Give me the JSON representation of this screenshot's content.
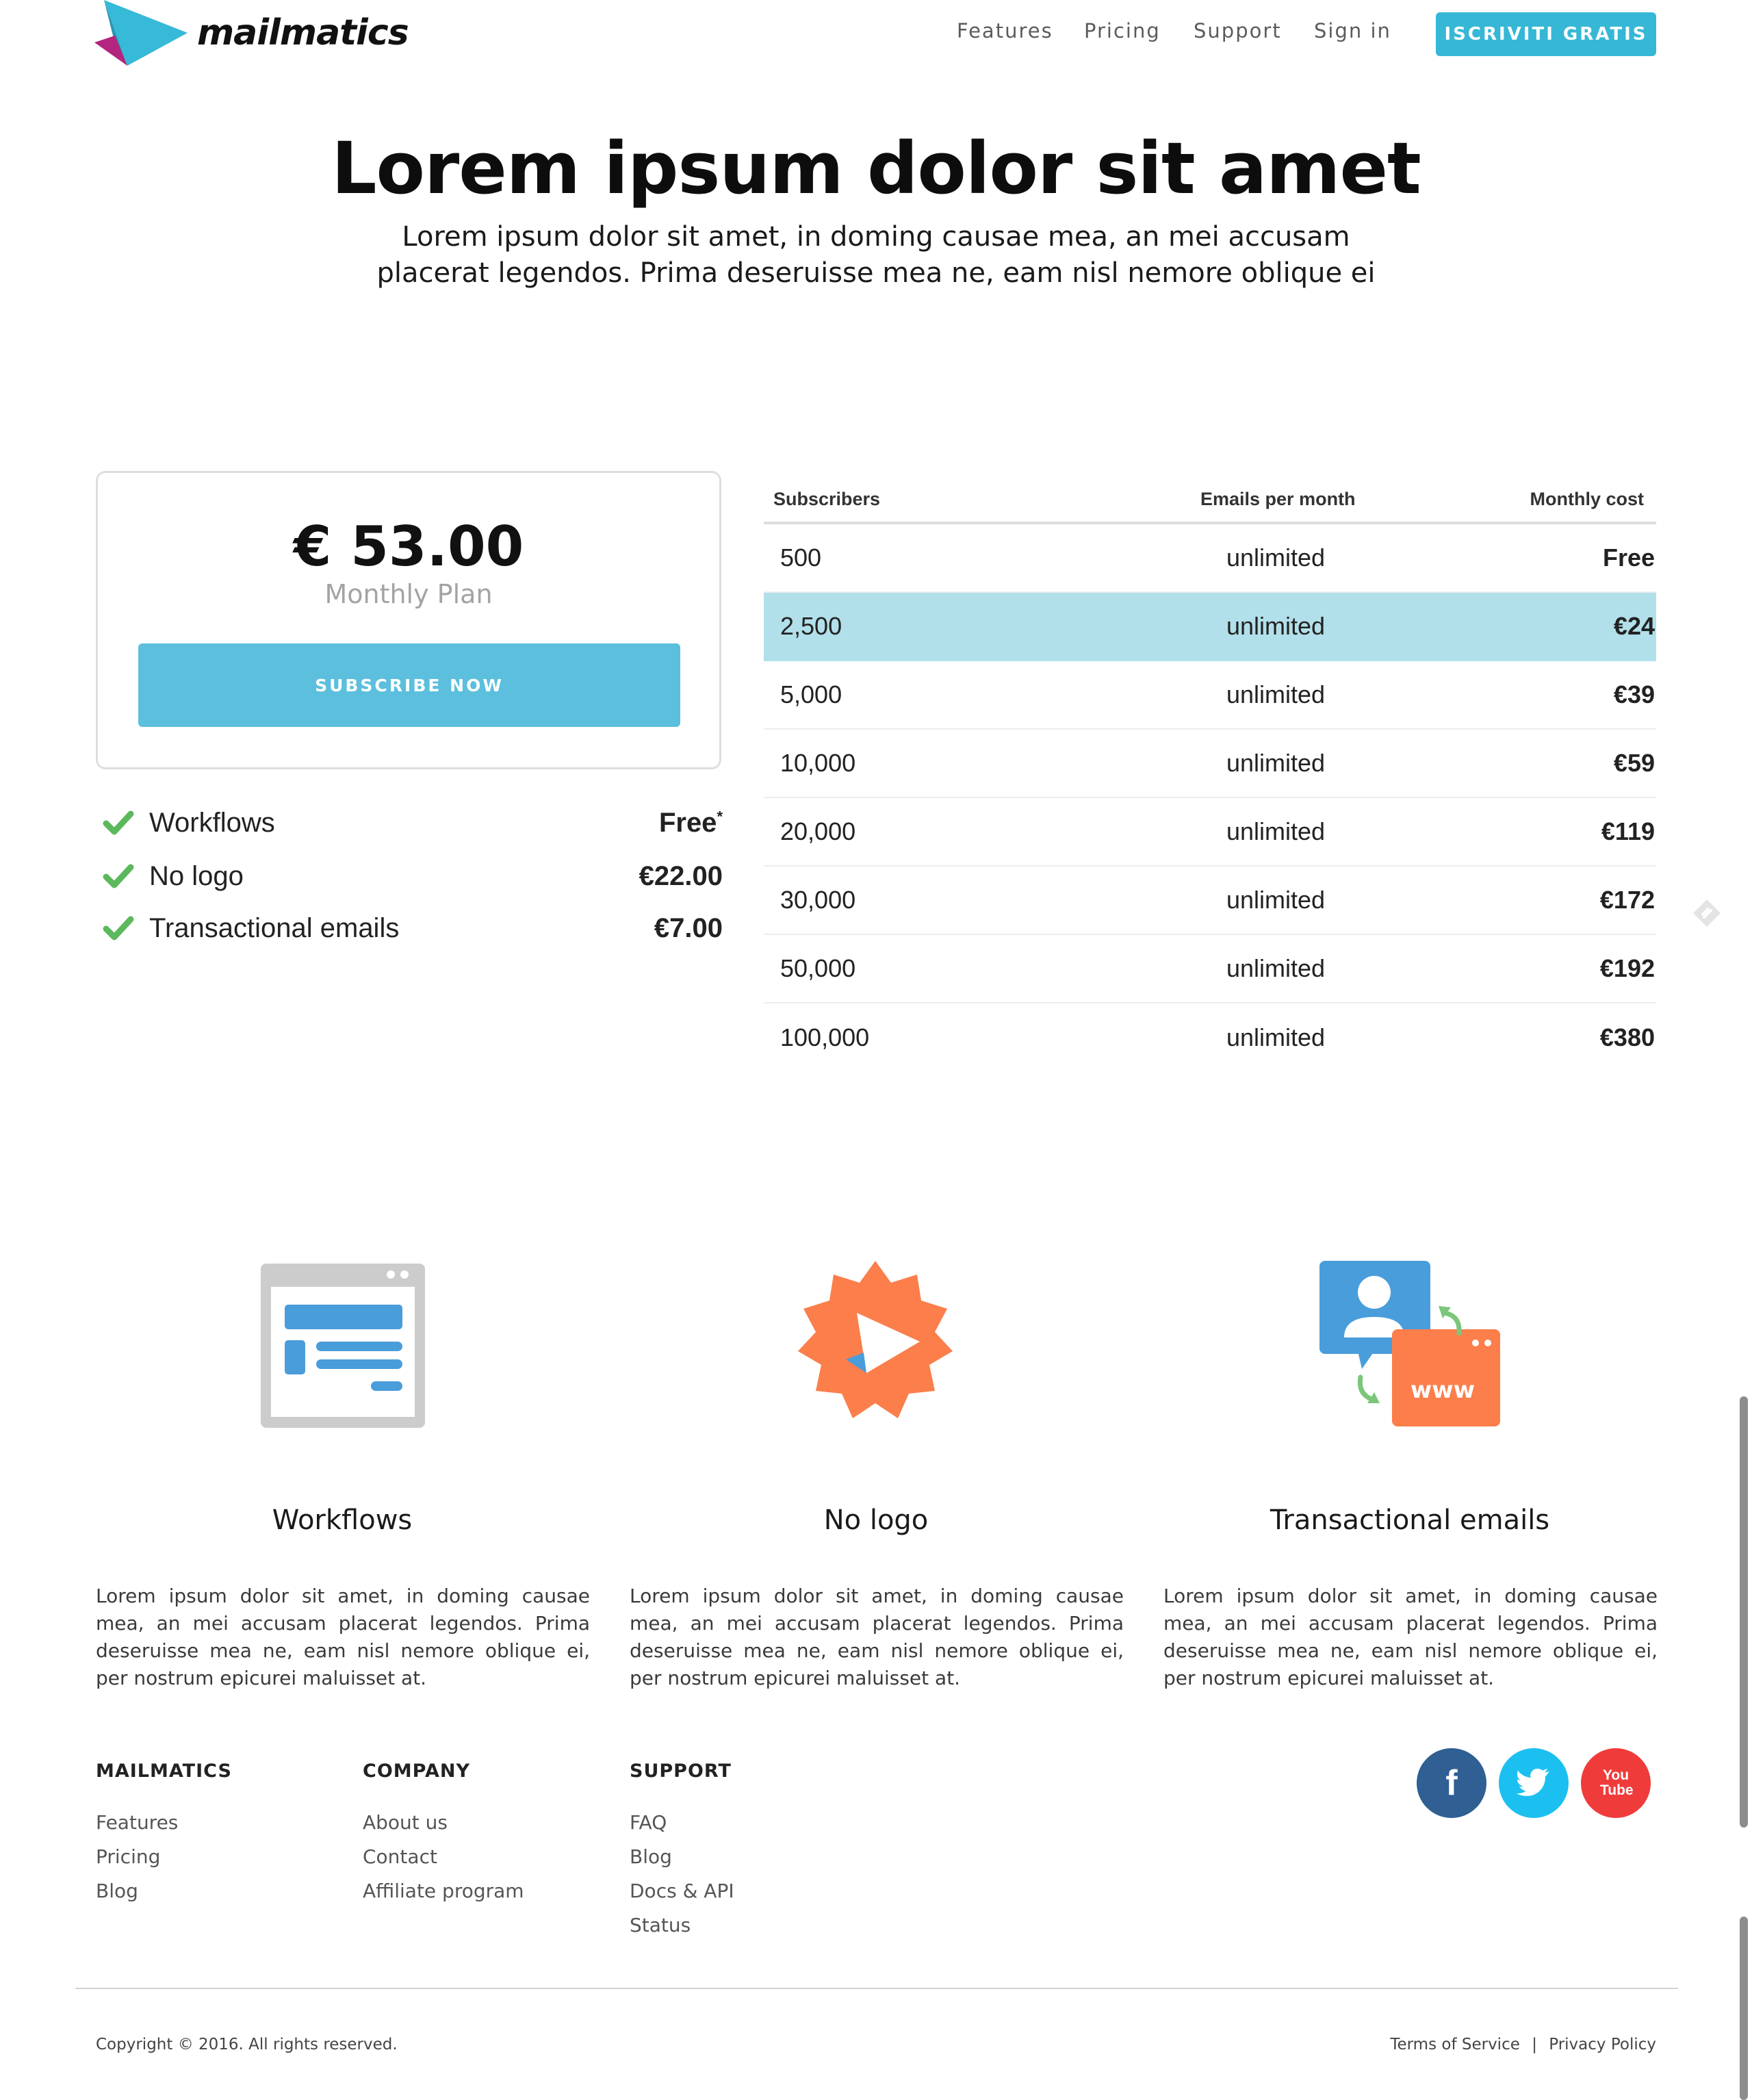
{
  "header": {
    "brand": "mailmatics",
    "nav": [
      "Features",
      "Pricing",
      "Support",
      "Sign in"
    ],
    "cta": "ISCRIVITI GRATIS"
  },
  "hero": {
    "title": "Lorem ipsum dolor sit amet",
    "subtitle_line1": "Lorem ipsum dolor sit amet, in doming causae mea, an mei accusam",
    "subtitle_line2": "placerat legendos. Prima deseruisse mea ne, eam nisl nemore oblique ei"
  },
  "plan": {
    "price": "€ 53.00",
    "name": "Monthly Plan",
    "button": "SUBSCRIBE NOW"
  },
  "addons": [
    {
      "label": "Workflows",
      "price": "Free",
      "note": "*"
    },
    {
      "label": "No logo",
      "price": "€22.00",
      "note": ""
    },
    {
      "label": "Transactional emails",
      "price": "€7.00",
      "note": ""
    }
  ],
  "pricing_table": {
    "headers": [
      "Subscribers",
      "Emails per month",
      "Monthly cost"
    ],
    "rows": [
      {
        "subscribers": "500",
        "emails": "unlimited",
        "cost": "Free"
      },
      {
        "subscribers": "2,500",
        "emails": "unlimited",
        "cost": "€24"
      },
      {
        "subscribers": "5,000",
        "emails": "unlimited",
        "cost": "€39"
      },
      {
        "subscribers": "10,000",
        "emails": "unlimited",
        "cost": "€59"
      },
      {
        "subscribers": "20,000",
        "emails": "unlimited",
        "cost": "€119"
      },
      {
        "subscribers": "30,000",
        "emails": "unlimited",
        "cost": "€172"
      },
      {
        "subscribers": "50,000",
        "emails": "unlimited",
        "cost": "€192"
      },
      {
        "subscribers": "100,000",
        "emails": "unlimited",
        "cost": "€380"
      }
    ],
    "highlighted_row": 1
  },
  "features": [
    {
      "icon": "browser-window-icon",
      "title": "Workflows",
      "text": "Lorem ipsum dolor sit amet, in doming causae mea, an mei accusam placerat legendos. Prima deseruisse mea ne, eam nisl nemore oblique ei, per nostrum epicurei maluisset at."
    },
    {
      "icon": "badge-play-icon",
      "title": "No logo",
      "text": "Lorem ipsum dolor sit amet, in doming causae mea, an mei accusam placerat legendos. Prima deseruisse mea ne, eam nisl nemore oblique ei, per nostrum epicurei maluisset at."
    },
    {
      "icon": "user-web-exchange-icon",
      "title": "Transactional emails",
      "text": "Lorem ipsum dolor sit amet, in doming causae mea, an mei accusam placerat legendos. Prima deseruisse mea ne, eam nisl nemore oblique ei, per nostrum epicurei maluisset at."
    }
  ],
  "footer": {
    "columns": [
      {
        "heading": "MAILMATICS",
        "links": [
          "Features",
          "Pricing",
          "Blog"
        ]
      },
      {
        "heading": "COMPANY",
        "links": [
          "About us",
          "Contact",
          "Affiliate program"
        ]
      },
      {
        "heading": "SUPPORT",
        "links": [
          "FAQ",
          "Blog",
          "Docs & API",
          "Status"
        ]
      }
    ],
    "social": [
      {
        "icon": "facebook-icon",
        "glyph": "f",
        "color": "#2f5f93"
      },
      {
        "icon": "twitter-icon",
        "glyph": "",
        "color": "#1cc0f0"
      },
      {
        "icon": "youtube-icon",
        "glyph": "You Tube",
        "color": "#f03b3b"
      }
    ],
    "copyright": "Copyright © 2016. All rights reserved.",
    "terms": "Terms of Service",
    "separator": "|",
    "privacy": "Privacy Policy"
  },
  "colors": {
    "accent": "#36b7d6",
    "button": "#5bbfdd",
    "highlight_row": "#b2e0ea",
    "check": "#5cb85c",
    "feature_orange": "#fb7e4b",
    "feature_blue": "#4a9ddb"
  }
}
